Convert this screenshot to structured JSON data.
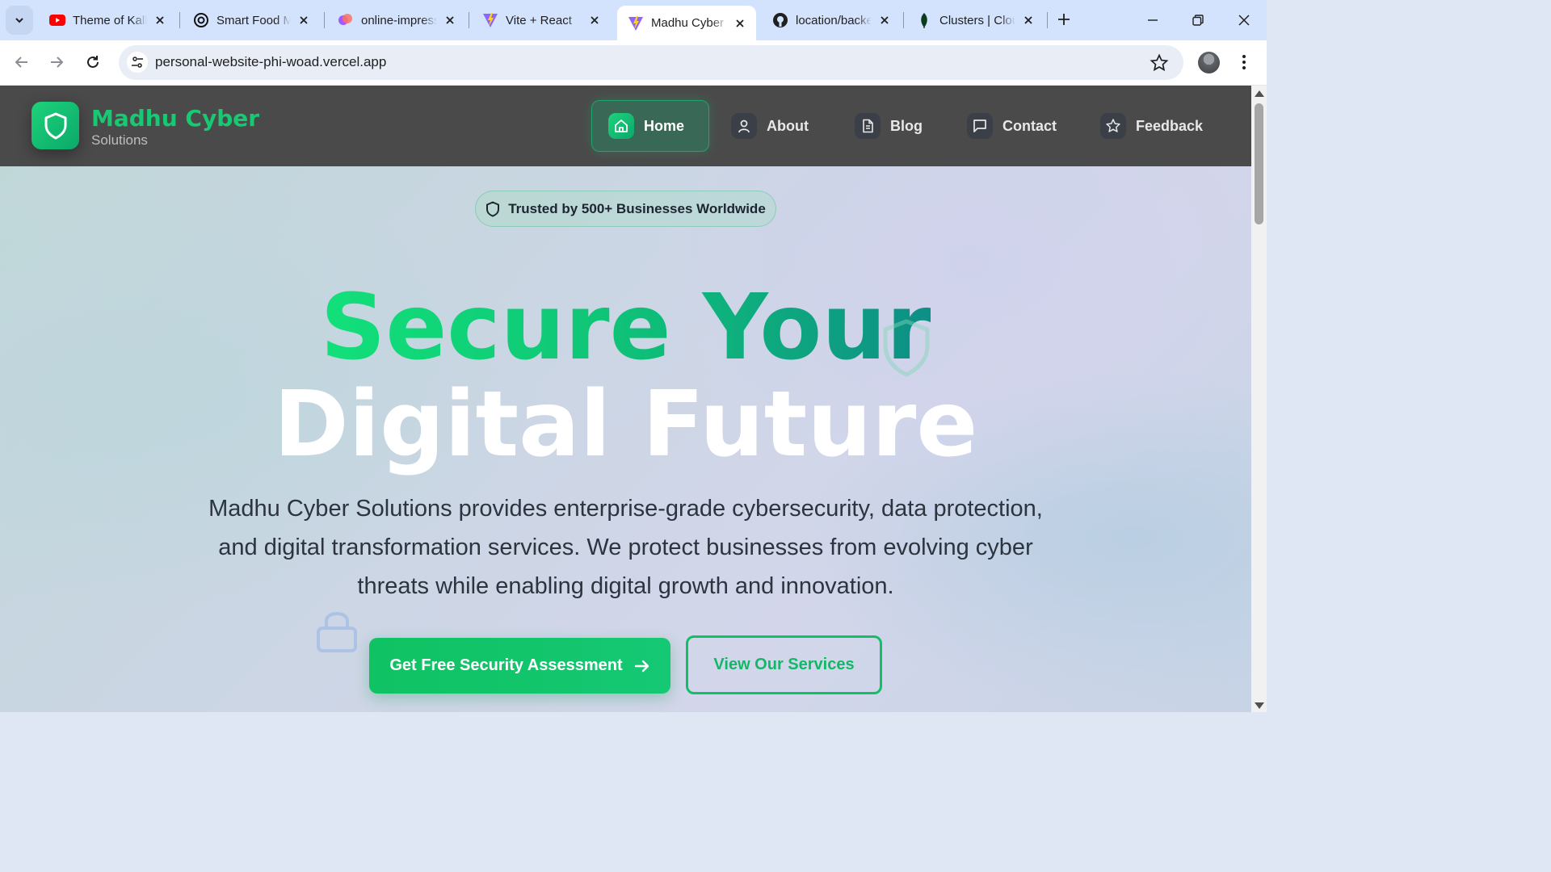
{
  "browser": {
    "tabs": [
      {
        "title": "Theme of Kalki",
        "icon": "youtube-icon",
        "color": "#ff0000"
      },
      {
        "title": "Smart Food Management",
        "icon": "openai-icon",
        "color": "#000000"
      },
      {
        "title": "online-impression",
        "icon": "figma-icon",
        "color": "#a259ff"
      },
      {
        "title": "Vite + React",
        "icon": "vite-icon",
        "color": "#bd34fe"
      },
      {
        "title": "Madhu Cyber Solutions",
        "icon": "vite-icon",
        "color": "#bd34fe",
        "active": true
      },
      {
        "title": "location/backend",
        "icon": "github-icon",
        "color": "#000000"
      },
      {
        "title": "Clusters | Cloud",
        "icon": "mongodb-icon",
        "color": "#0a3d1e"
      }
    ],
    "url": "personal-website-phi-woad.vercel.app"
  },
  "site": {
    "brand": {
      "name": "Madhu Cyber",
      "subtitle": "Solutions"
    },
    "nav": [
      {
        "label": "Home",
        "icon": "home-icon",
        "active": true
      },
      {
        "label": "About",
        "icon": "user-icon"
      },
      {
        "label": "Blog",
        "icon": "document-icon"
      },
      {
        "label": "Contact",
        "icon": "chat-icon"
      },
      {
        "label": "Feedback",
        "icon": "star-icon"
      }
    ],
    "trust_badge": "Trusted by 500+ Businesses Worldwide",
    "hero": {
      "line1": "Secure Your",
      "line2": "Digital Future",
      "description": "Madhu Cyber Solutions provides enterprise-grade cybersecurity, data protection, and digital transformation services. We protect businesses from evolving cyber threats while enabling digital growth and innovation."
    },
    "cta_primary": "Get Free Security Assessment",
    "cta_secondary": "View Our Services",
    "colors": {
      "accent": "#10c068",
      "nav_bg": "#4a4a4a"
    }
  }
}
